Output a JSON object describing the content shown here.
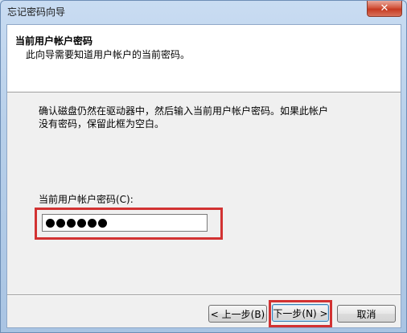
{
  "window": {
    "title": "忘记密码向导",
    "close_symbol": "✕"
  },
  "header": {
    "title": "当前用户帐户密码",
    "subtitle": "此向导需要知道用户帐户的当前密码。"
  },
  "body": {
    "description_line1": "确认磁盘仍然在驱动器中，然后输入当前用户帐户密码。如果此帐户",
    "description_line2": "没有密码，保留此框为空白。",
    "password_label": "当前用户帐户密码(C):",
    "password_length": 6
  },
  "buttons": {
    "back": "< 上一步(B)",
    "next": "下一步(N) >",
    "cancel": "取消"
  },
  "colors": {
    "highlight": "#d23232",
    "title_bar": "#b7cfe9",
    "close_button": "#c53a22"
  }
}
